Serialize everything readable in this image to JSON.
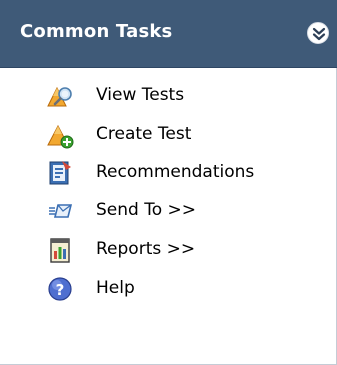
{
  "panel": {
    "title": "Common Tasks",
    "colors": {
      "header_bg": "#3f5a78",
      "header_text": "#ffffff"
    }
  },
  "tasks": [
    {
      "label": "View Tests",
      "icon": "view-tests-icon"
    },
    {
      "label": "Create Test",
      "icon": "create-test-icon"
    },
    {
      "label": "Recommendations",
      "icon": "recommendations-icon"
    },
    {
      "label": "Send To >>",
      "icon": "send-to-icon"
    },
    {
      "label": "Reports >>",
      "icon": "reports-icon"
    },
    {
      "label": "Help",
      "icon": "help-icon"
    }
  ]
}
